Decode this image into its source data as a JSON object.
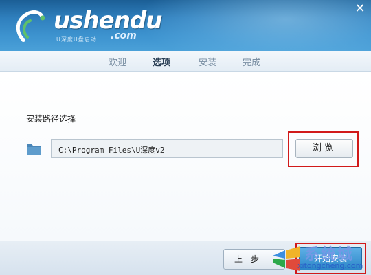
{
  "header": {
    "logo_text": "ushendu",
    "logo_dotcom": ".com",
    "logo_subtitle": "U深度U盘启动",
    "close_glyph": "✕"
  },
  "tabs": [
    {
      "label": "欢迎",
      "active": false
    },
    {
      "label": "选项",
      "active": true
    },
    {
      "label": "安装",
      "active": false
    },
    {
      "label": "完成",
      "active": false
    }
  ],
  "content": {
    "path_label": "安装路径选择",
    "path_value": "C:\\Program Files\\U深度v2",
    "browse_label": "浏览",
    "folder_icon": "folder-icon"
  },
  "footer": {
    "prev_label": "上一步",
    "start_label": "开始安装"
  },
  "watermark": {
    "text": "系统城",
    "url": "xitongcheng.com"
  },
  "colors": {
    "header_blue": "#2f7fbd",
    "highlight_red": "#d11a1a",
    "start_button_blue": "#2c86c8"
  }
}
